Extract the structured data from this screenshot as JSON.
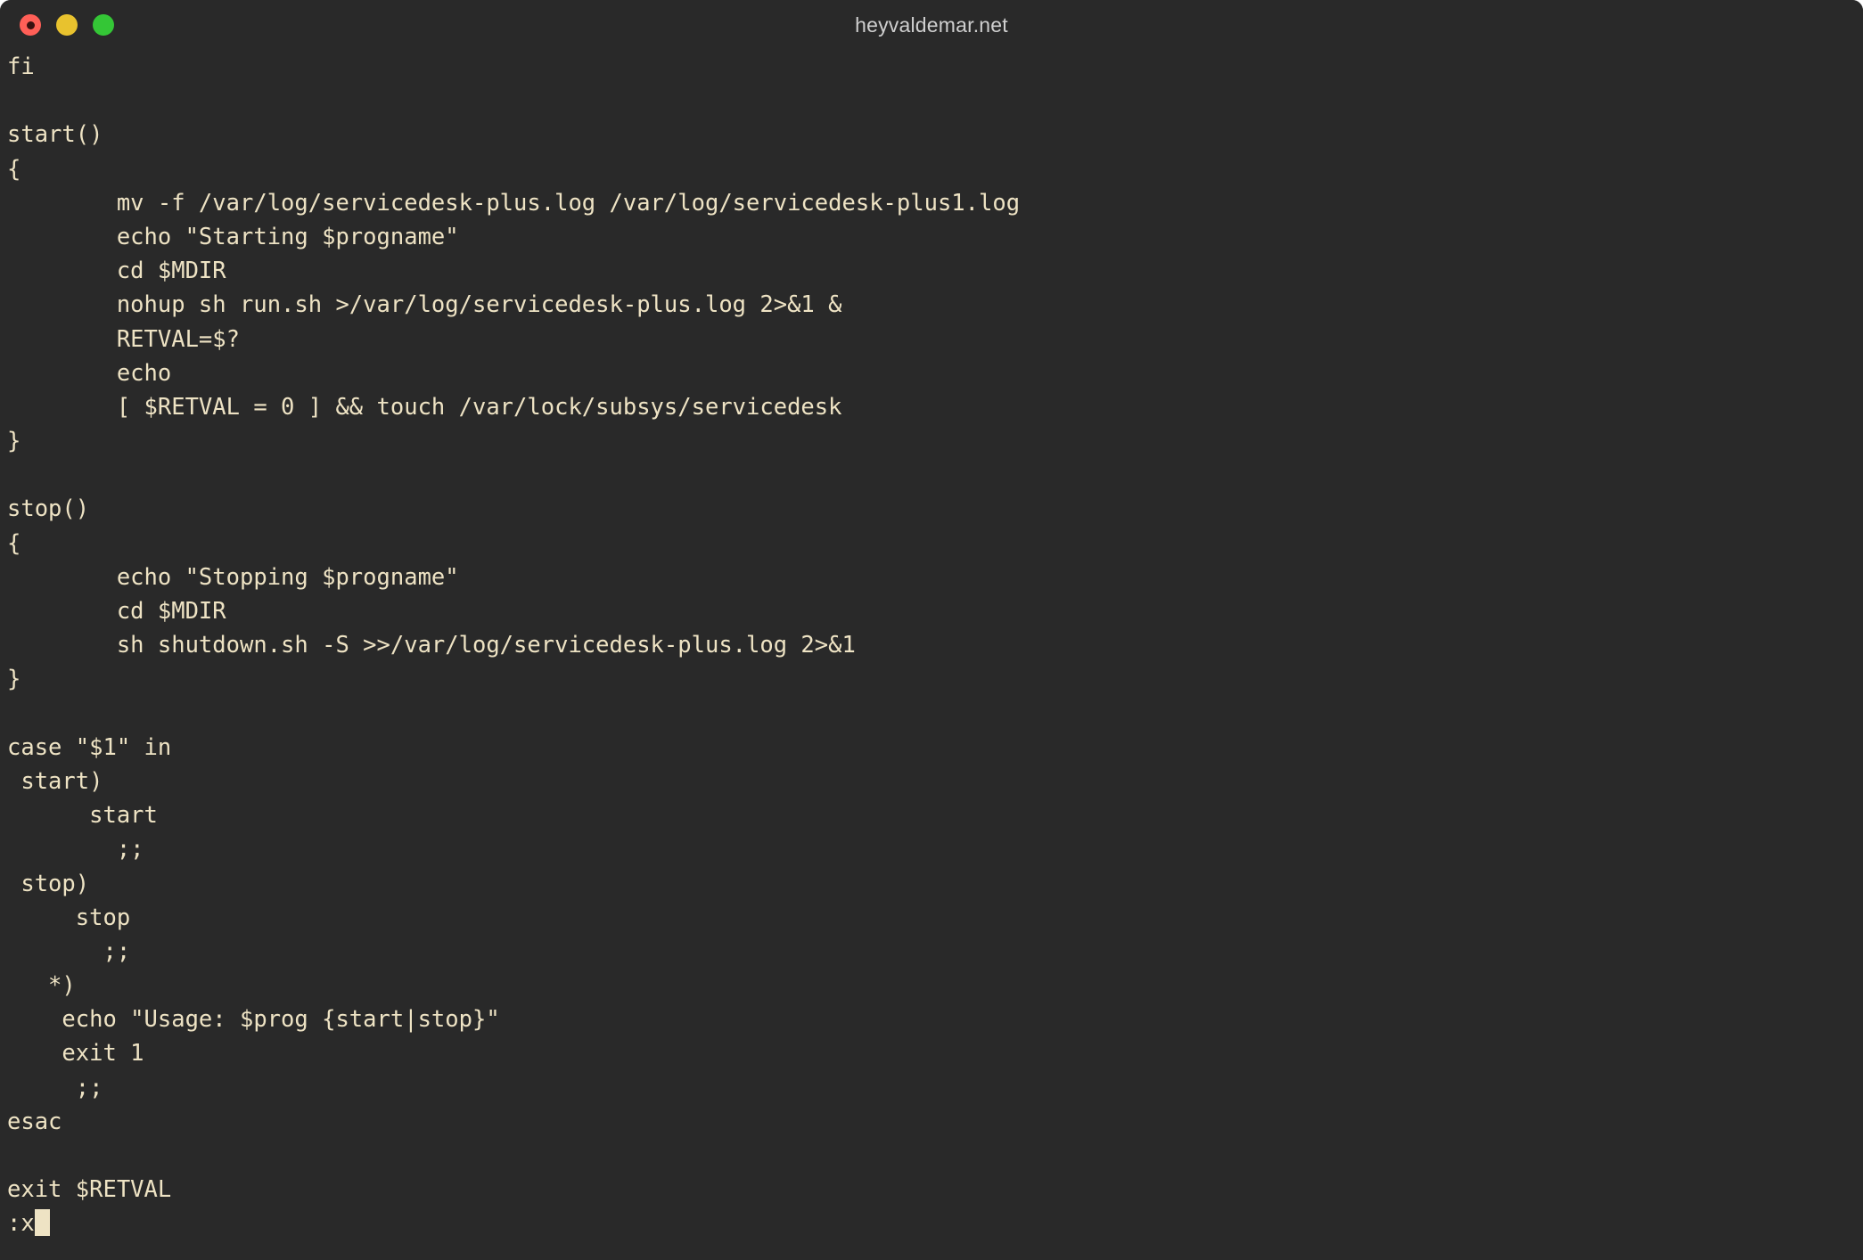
{
  "window": {
    "title": "heyvaldemar.net",
    "background_color": "#292929",
    "text_color": "#eee3c4",
    "traffic_lights": [
      {
        "name": "close",
        "color": "#ff5f57"
      },
      {
        "name": "minimize",
        "color": "#e8c22e"
      },
      {
        "name": "maximize",
        "color": "#34c636"
      }
    ]
  },
  "terminal": {
    "editor": "vi",
    "command_line": ":x",
    "lines": [
      "fi",
      "",
      "start()",
      "{",
      "        mv -f /var/log/servicedesk-plus.log /var/log/servicedesk-plus1.log",
      "        echo \"Starting $progname\"",
      "        cd $MDIR",
      "        nohup sh run.sh >/var/log/servicedesk-plus.log 2>&1 &",
      "        RETVAL=$?",
      "        echo",
      "        [ $RETVAL = 0 ] && touch /var/lock/subsys/servicedesk",
      "}",
      "",
      "stop()",
      "{",
      "        echo \"Stopping $progname\"",
      "        cd $MDIR",
      "        sh shutdown.sh -S >>/var/log/servicedesk-plus.log 2>&1",
      "}",
      "",
      "case \"$1\" in",
      " start)",
      "      start",
      "        ;;",
      " stop)",
      "     stop",
      "       ;;",
      "   *)",
      "    echo \"Usage: $prog {start|stop}\"",
      "    exit 1",
      "     ;;",
      "esac",
      "",
      "exit $RETVAL"
    ]
  }
}
